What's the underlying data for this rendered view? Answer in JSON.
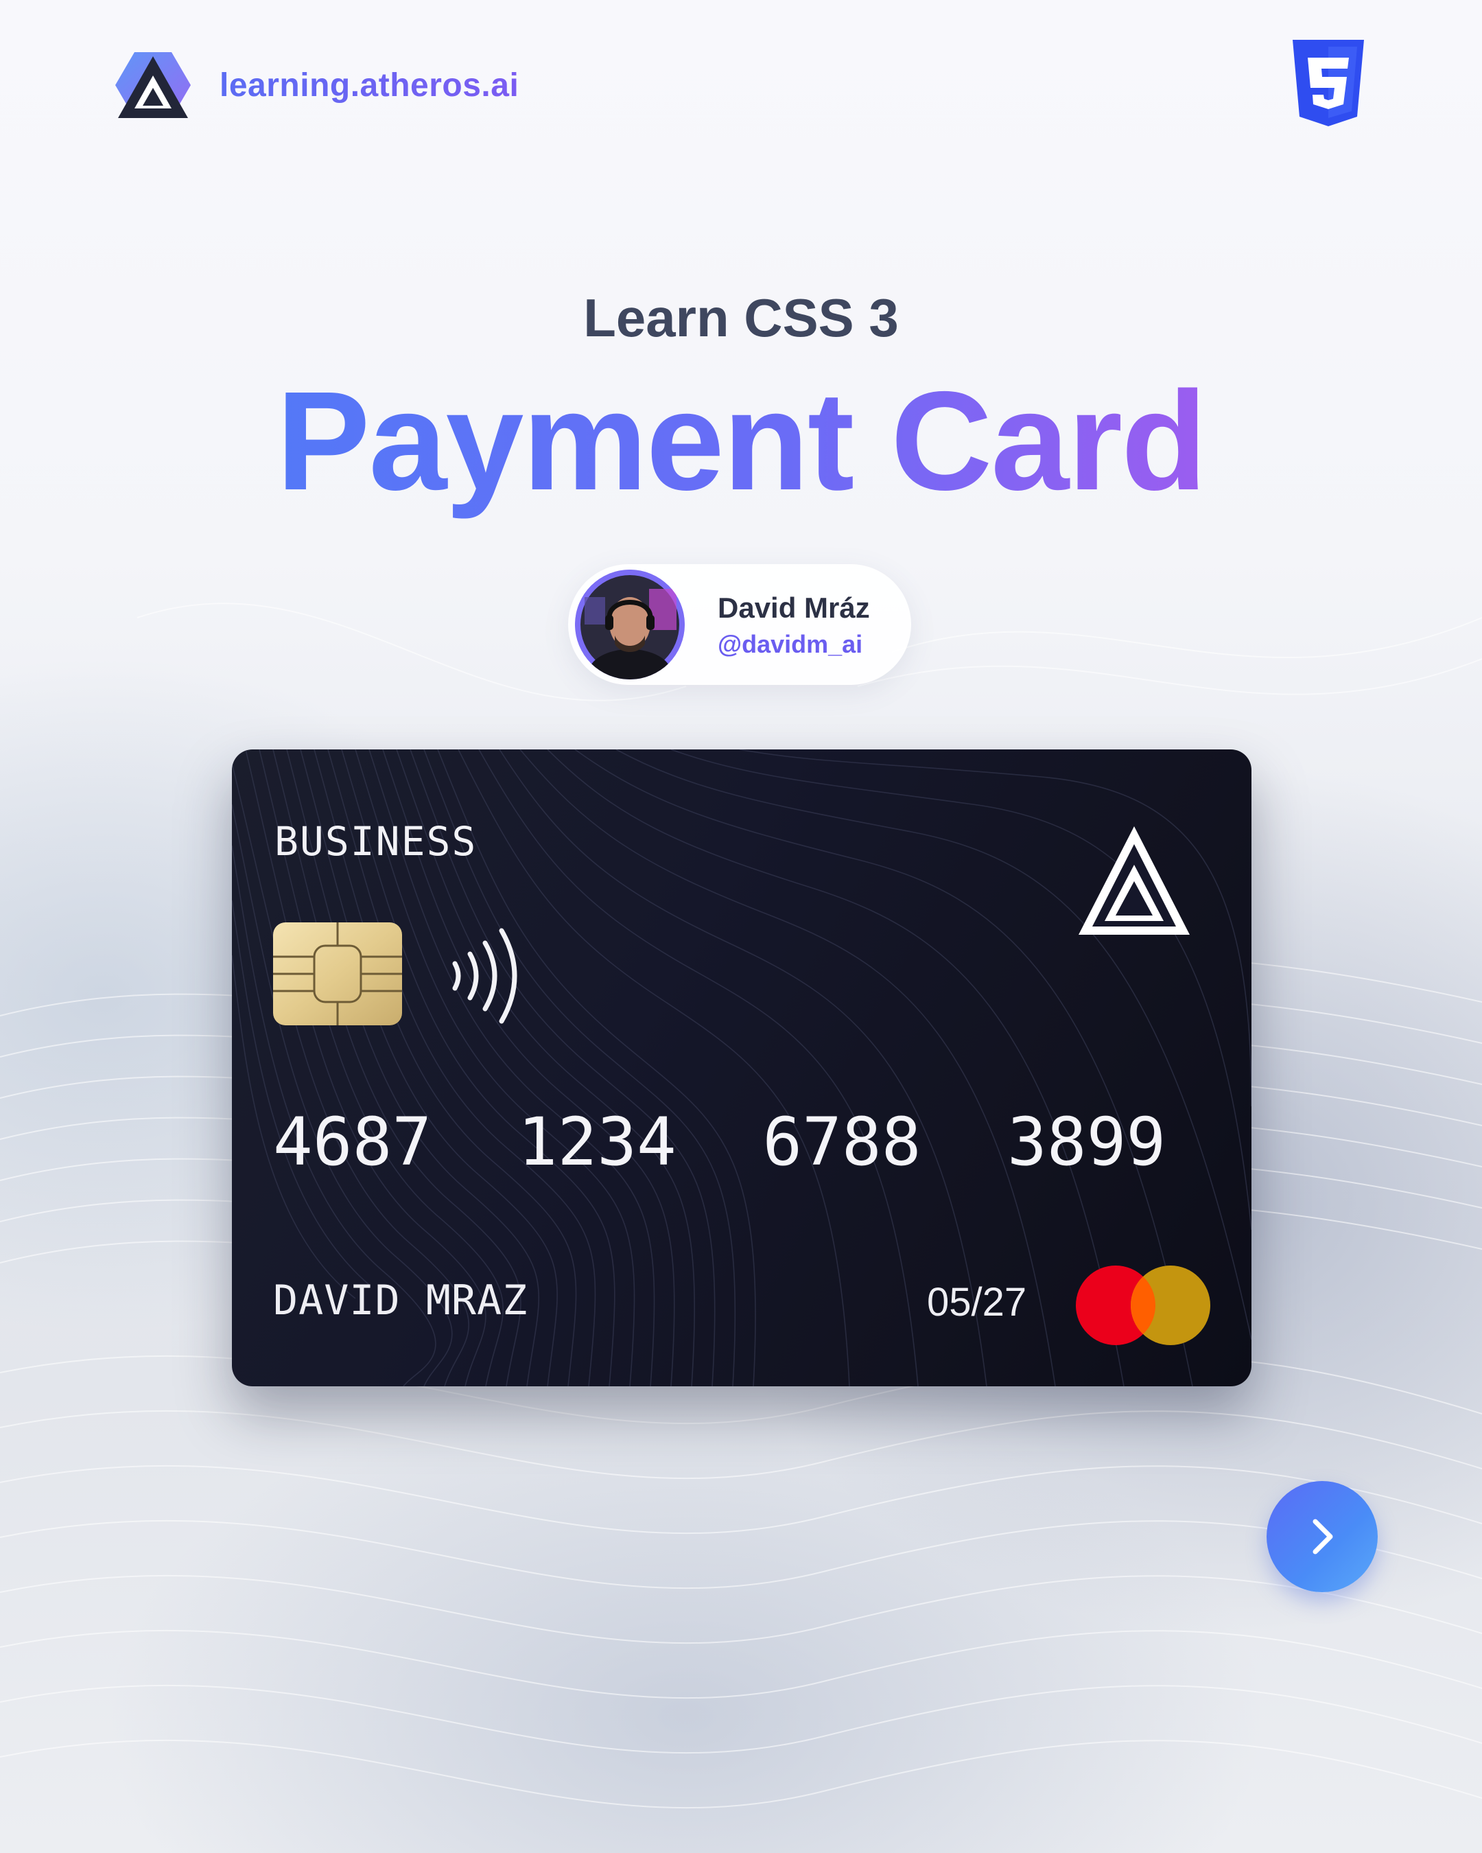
{
  "header": {
    "url": "learning.atheros.ai",
    "logo_icon": "atheros-logo-icon",
    "tech_icon": "css3-icon"
  },
  "hero": {
    "subtitle": "Learn CSS 3",
    "title": "Payment Card"
  },
  "author": {
    "name": "David Mráz",
    "handle": "@davidm_ai"
  },
  "card": {
    "type": "BUSINESS",
    "number_groups": [
      "4687",
      "1234",
      "6788",
      "3899"
    ],
    "holder": "DAVID MRAZ",
    "expiry": "05/27",
    "network_icon": "mastercard-icon",
    "colors": {
      "background": "#141626",
      "mastercard_red": "#eb001b",
      "mastercard_yellow": "#c4950f",
      "chip_gold": "#e8d49c"
    }
  },
  "navigation": {
    "next_icon": "chevron-right-icon",
    "accent": "#5a6cf5"
  }
}
